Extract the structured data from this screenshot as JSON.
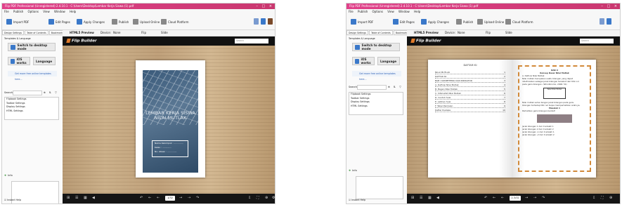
{
  "app": {
    "title_a": "Flip PDF Professional (Unregistered) 2.4.10.1 - C:\\Users\\Desktop\\Lembar Kerja Siswa (1).pdf",
    "title_b": "Flip PDF Professional (Unregistered) 2.4.10.1 - C:\\Users\\Desktop\\Lembar Kerja Siswa (1).pdf",
    "window_buttons": "– □ ×",
    "menu": [
      "File",
      "Publish",
      "Options",
      "View",
      "Window",
      "Help"
    ]
  },
  "ribbon": {
    "import_pdf": "Import PDF",
    "edit_pages": "Edit Pages",
    "apply_changes": "Apply Changes",
    "publish": "Publish",
    "upload_online": "Upload Online",
    "cloud_platform": "Cloud Platform"
  },
  "panel_tabs": [
    "Design Settings",
    "Table of Contents",
    "Bookmark Table"
  ],
  "viewer_header": {
    "mode": "HTML5 Preview",
    "device_label": "Device:",
    "device": "None",
    "flip_label": "Flip",
    "slide_label": "Slide"
  },
  "sidebar": {
    "template_label": "Templates & Language",
    "switch_desktop": "Switch to desktop mode",
    "ios_works": "iOS works",
    "language": "Language",
    "get_more": "Get more free online templates here...",
    "search_label": "Search",
    "settings_list": [
      "Flipbook Settings",
      "Toolbar Settings",
      "Display Settings",
      "HTML Settings"
    ],
    "info_label": "Info",
    "instant_help": "Instant Help"
  },
  "viewer": {
    "logo": "Flip Builder",
    "search_placeholder": "Search",
    "page_a": "1/32",
    "page_b": "2-3/32"
  },
  "book_a": {
    "cover_title": "LEMBAR KERJA SISWA NILAI MUTLAK",
    "fields": [
      "Nama Kelompok : ..............",
      "Kelas : ..............",
      "No. Absen : .............."
    ]
  },
  "book_b": {
    "toc_heading": "DAFTAR ISI",
    "toc": [
      [
        "NILAI MUTLAK",
        "1"
      ],
      [
        "DAFTAR ISI",
        "2"
      ],
      [
        "BAB I KOMPETENSI DAN INDIKATOR",
        "3"
      ],
      [
        "A. Definisi Nilai Mutlak",
        "4"
      ],
      [
        "B. Bagan Nilai Mutlak",
        "5"
      ],
      [
        "C. Sifat-sifat Nilai Mutlak",
        "6"
      ],
      [
        "D. Contoh Soal",
        "7"
      ],
      [
        "E. Latihan Soal",
        "8"
      ],
      [
        "F. Tabel Penilaian",
        "9"
      ],
      [
        "Daftar Pustaka",
        "10"
      ]
    ],
    "right_title": "BAB II",
    "right_subtitle": "Konsep Dasar Nilai Mutlak",
    "right_lines": [
      "A. Definisi Nilai Mutlak",
      "Nilai mutlak merupakan suatu bilangan yang dapat",
      "didefinisikan sebagai jarak bilangan tersebut dari titik nol",
      "pada garis bilangan. (Wirodikromo, 2006: 54)",
      "Tabel Nilai Mutlak",
      "Nilai mutlak sama dengan jarak bilangan pada garis",
      "bilangan terhadap titik nol tanpa memperhatikan arahnya.",
      "Masalah 1",
      "Perhatikan garis bilangan berikut!",
      "Jarak bilangan 1 dari 0 adalah 1",
      "Jarak bilangan 2 dari 0 adalah 2",
      "Jarak bilangan -1 dari 0 adalah 1",
      "Jarak bilangan -2 dari 0 adalah 2"
    ]
  }
}
